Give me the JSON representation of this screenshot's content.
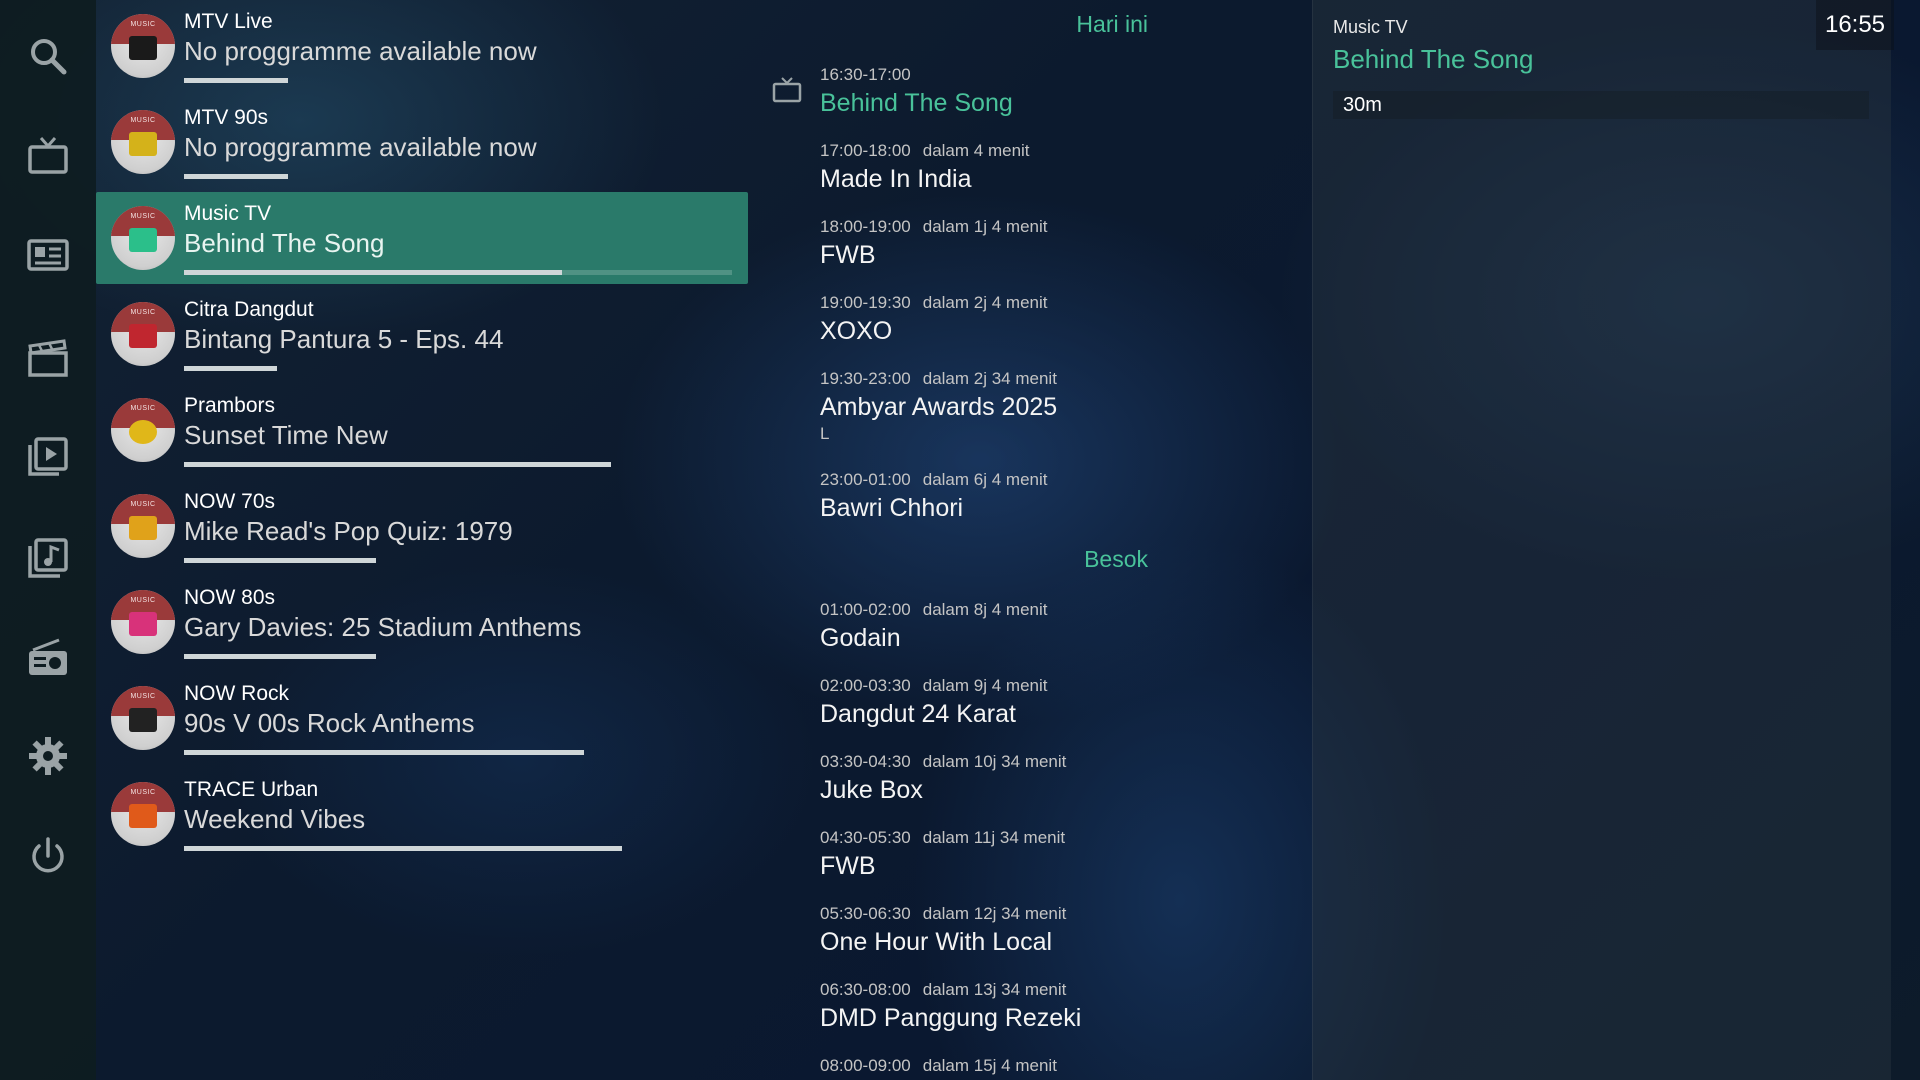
{
  "sidebar": {
    "items": [
      {
        "icon": "search-icon"
      },
      {
        "icon": "tv-icon"
      },
      {
        "icon": "guide-icon"
      },
      {
        "icon": "movies-icon"
      },
      {
        "icon": "videos-icon"
      },
      {
        "icon": "music-library-icon"
      },
      {
        "icon": "radio-icon"
      },
      {
        "icon": "settings-gear-icon"
      },
      {
        "icon": "power-icon"
      }
    ]
  },
  "channels": [
    {
      "name": "MTV Live",
      "programme": "No proggramme available now",
      "progress": 0.19,
      "logo_badge": "MUSIC",
      "logo_color": "#1a1a1a"
    },
    {
      "name": "MTV 90s",
      "programme": "No proggramme available now",
      "progress": 0.19,
      "logo_badge": "MUSIC",
      "logo_color": "#d4b21a"
    },
    {
      "name": "Music TV",
      "programme": "Behind The Song",
      "progress": 0.69,
      "logo_badge": "MUSIC",
      "logo_color": "#2bbf8a",
      "selected": true
    },
    {
      "name": "Citra Dangdut",
      "programme": "Bintang Pantura 5 - Eps. 44",
      "progress": 0.17,
      "logo_badge": "MUSIC",
      "logo_color": "#c0262f"
    },
    {
      "name": "Prambors",
      "programme": "Sunset Time New",
      "progress": 0.78,
      "logo_badge": "MUSIC",
      "logo_color": "#e0b719"
    },
    {
      "name": "NOW 70s",
      "programme": "Mike Read's Pop Quiz: 1979",
      "progress": 0.35,
      "logo_badge": "MUSIC",
      "logo_color": "#e0a21a"
    },
    {
      "name": "NOW 80s",
      "programme": "Gary Davies: 25 Stadium Anthems",
      "progress": 0.35,
      "logo_badge": "MUSIC",
      "logo_color": "#d8327a"
    },
    {
      "name": "NOW Rock",
      "programme": "90s V 00s Rock Anthems",
      "progress": 0.73,
      "logo_badge": "MUSIC",
      "logo_color": "#222222"
    },
    {
      "name": "TRACE Urban",
      "programme": "Weekend Vibes",
      "progress": 0.8,
      "logo_badge": "MUSIC",
      "logo_color": "#e05a1a"
    }
  ],
  "schedule": {
    "today_label": "Hari ini",
    "tomorrow_label": "Besok",
    "today": [
      {
        "time": "16:30-17:00",
        "relative": "",
        "title": "Behind The Song",
        "current": true,
        "extra": ""
      },
      {
        "time": "17:00-18:00",
        "relative": "dalam 4 menit",
        "title": "Made In India",
        "extra": ""
      },
      {
        "time": "18:00-19:00",
        "relative": "dalam 1j 4 menit",
        "title": "FWB",
        "extra": ""
      },
      {
        "time": "19:00-19:30",
        "relative": "dalam 2j 4 menit",
        "title": "XOXO",
        "extra": ""
      },
      {
        "time": "19:30-23:00",
        "relative": "dalam 2j 34 menit",
        "title": "Ambyar Awards 2025",
        "extra": "L"
      },
      {
        "time": "23:00-01:00",
        "relative": "dalam 6j 4 menit",
        "title": "Bawri Chhori",
        "extra": ""
      }
    ],
    "tomorrow": [
      {
        "time": "01:00-02:00",
        "relative": "dalam 8j 4 menit",
        "title": "Godain"
      },
      {
        "time": "02:00-03:30",
        "relative": "dalam 9j 4 menit",
        "title": "Dangdut 24 Karat"
      },
      {
        "time": "03:30-04:30",
        "relative": "dalam 10j 34 menit",
        "title": "Juke Box"
      },
      {
        "time": "04:30-05:30",
        "relative": "dalam 11j 34 menit",
        "title": "FWB"
      },
      {
        "time": "05:30-06:30",
        "relative": "dalam 12j 34 menit",
        "title": "One Hour With Local"
      },
      {
        "time": "06:30-08:00",
        "relative": "dalam 13j 34 menit",
        "title": "DMD Panggung Rezeki"
      },
      {
        "time": "08:00-09:00",
        "relative": "dalam 15j 4 menit",
        "title": ""
      }
    ]
  },
  "detail": {
    "channel": "Music TV",
    "title": "Behind The Song",
    "duration": "30m"
  },
  "clock": "16:55",
  "colors": {
    "accent": "#49c29a",
    "selected_row": "#2a7a6a",
    "sidebar": "#0e1c21"
  }
}
